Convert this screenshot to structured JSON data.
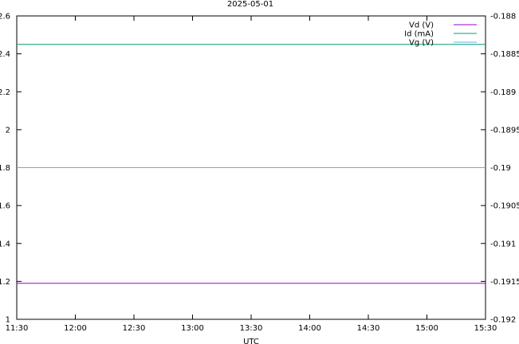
{
  "chart_data": {
    "type": "line",
    "title": "2025-05-01",
    "xlabel": "UTC",
    "ylabel": "",
    "y2label": "",
    "x_range": [
      "11:30",
      "15:30"
    ],
    "x_ticks": [
      "11:30",
      "12:00",
      "12:30",
      "13:00",
      "13:30",
      "14:00",
      "14:30",
      "15:00",
      "15:30"
    ],
    "ylim": [
      1.0,
      2.6
    ],
    "y_ticks": [
      "1",
      "1.2",
      "1.4",
      "1.6",
      "1.8",
      "2",
      "2.2",
      "2.4",
      "2.6"
    ],
    "y2lim": [
      -0.192,
      -0.188
    ],
    "y2_ticks": [
      "-0.192",
      "-0.1915",
      "-0.191",
      "-0.1905",
      "-0.19",
      "-0.1895",
      "-0.189",
      "-0.1885",
      "-0.188"
    ],
    "grid": false,
    "legend_position": "top-right",
    "series": [
      {
        "name": "Vd (V)",
        "axis": "left",
        "color": "#9400d3",
        "x": [
          "11:30",
          "15:30"
        ],
        "y": [
          1.19,
          1.19
        ]
      },
      {
        "name": "Id (mA)",
        "axis": "left",
        "color": "#009e73",
        "x": [
          "11:30",
          "15:30"
        ],
        "y": [
          2.45,
          2.45
        ]
      },
      {
        "name": "Vg (V)",
        "axis": "right",
        "color": "#56b4e9",
        "x": [
          "11:30",
          "15:30"
        ],
        "y": [
          -0.19,
          -0.19
        ]
      }
    ]
  }
}
